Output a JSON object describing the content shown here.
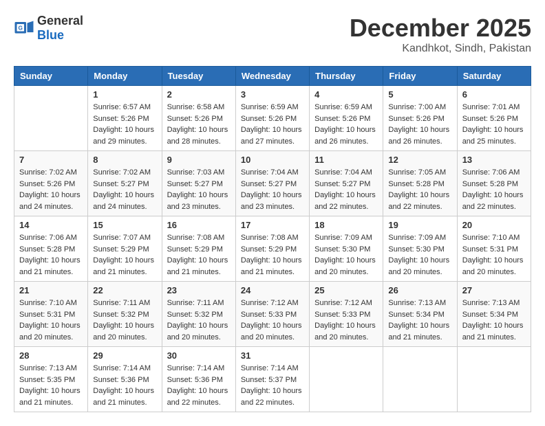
{
  "logo": {
    "general": "General",
    "blue": "Blue"
  },
  "title": "December 2025",
  "location": "Kandhkot, Sindh, Pakistan",
  "days_of_week": [
    "Sunday",
    "Monday",
    "Tuesday",
    "Wednesday",
    "Thursday",
    "Friday",
    "Saturday"
  ],
  "weeks": [
    [
      {
        "day": "",
        "sunrise": "",
        "sunset": "",
        "daylight": ""
      },
      {
        "day": "1",
        "sunrise": "Sunrise: 6:57 AM",
        "sunset": "Sunset: 5:26 PM",
        "daylight": "Daylight: 10 hours and 29 minutes."
      },
      {
        "day": "2",
        "sunrise": "Sunrise: 6:58 AM",
        "sunset": "Sunset: 5:26 PM",
        "daylight": "Daylight: 10 hours and 28 minutes."
      },
      {
        "day": "3",
        "sunrise": "Sunrise: 6:59 AM",
        "sunset": "Sunset: 5:26 PM",
        "daylight": "Daylight: 10 hours and 27 minutes."
      },
      {
        "day": "4",
        "sunrise": "Sunrise: 6:59 AM",
        "sunset": "Sunset: 5:26 PM",
        "daylight": "Daylight: 10 hours and 26 minutes."
      },
      {
        "day": "5",
        "sunrise": "Sunrise: 7:00 AM",
        "sunset": "Sunset: 5:26 PM",
        "daylight": "Daylight: 10 hours and 26 minutes."
      },
      {
        "day": "6",
        "sunrise": "Sunrise: 7:01 AM",
        "sunset": "Sunset: 5:26 PM",
        "daylight": "Daylight: 10 hours and 25 minutes."
      }
    ],
    [
      {
        "day": "7",
        "sunrise": "Sunrise: 7:02 AM",
        "sunset": "Sunset: 5:26 PM",
        "daylight": "Daylight: 10 hours and 24 minutes."
      },
      {
        "day": "8",
        "sunrise": "Sunrise: 7:02 AM",
        "sunset": "Sunset: 5:27 PM",
        "daylight": "Daylight: 10 hours and 24 minutes."
      },
      {
        "day": "9",
        "sunrise": "Sunrise: 7:03 AM",
        "sunset": "Sunset: 5:27 PM",
        "daylight": "Daylight: 10 hours and 23 minutes."
      },
      {
        "day": "10",
        "sunrise": "Sunrise: 7:04 AM",
        "sunset": "Sunset: 5:27 PM",
        "daylight": "Daylight: 10 hours and 23 minutes."
      },
      {
        "day": "11",
        "sunrise": "Sunrise: 7:04 AM",
        "sunset": "Sunset: 5:27 PM",
        "daylight": "Daylight: 10 hours and 22 minutes."
      },
      {
        "day": "12",
        "sunrise": "Sunrise: 7:05 AM",
        "sunset": "Sunset: 5:28 PM",
        "daylight": "Daylight: 10 hours and 22 minutes."
      },
      {
        "day": "13",
        "sunrise": "Sunrise: 7:06 AM",
        "sunset": "Sunset: 5:28 PM",
        "daylight": "Daylight: 10 hours and 22 minutes."
      }
    ],
    [
      {
        "day": "14",
        "sunrise": "Sunrise: 7:06 AM",
        "sunset": "Sunset: 5:28 PM",
        "daylight": "Daylight: 10 hours and 21 minutes."
      },
      {
        "day": "15",
        "sunrise": "Sunrise: 7:07 AM",
        "sunset": "Sunset: 5:29 PM",
        "daylight": "Daylight: 10 hours and 21 minutes."
      },
      {
        "day": "16",
        "sunrise": "Sunrise: 7:08 AM",
        "sunset": "Sunset: 5:29 PM",
        "daylight": "Daylight: 10 hours and 21 minutes."
      },
      {
        "day": "17",
        "sunrise": "Sunrise: 7:08 AM",
        "sunset": "Sunset: 5:29 PM",
        "daylight": "Daylight: 10 hours and 21 minutes."
      },
      {
        "day": "18",
        "sunrise": "Sunrise: 7:09 AM",
        "sunset": "Sunset: 5:30 PM",
        "daylight": "Daylight: 10 hours and 20 minutes."
      },
      {
        "day": "19",
        "sunrise": "Sunrise: 7:09 AM",
        "sunset": "Sunset: 5:30 PM",
        "daylight": "Daylight: 10 hours and 20 minutes."
      },
      {
        "day": "20",
        "sunrise": "Sunrise: 7:10 AM",
        "sunset": "Sunset: 5:31 PM",
        "daylight": "Daylight: 10 hours and 20 minutes."
      }
    ],
    [
      {
        "day": "21",
        "sunrise": "Sunrise: 7:10 AM",
        "sunset": "Sunset: 5:31 PM",
        "daylight": "Daylight: 10 hours and 20 minutes."
      },
      {
        "day": "22",
        "sunrise": "Sunrise: 7:11 AM",
        "sunset": "Sunset: 5:32 PM",
        "daylight": "Daylight: 10 hours and 20 minutes."
      },
      {
        "day": "23",
        "sunrise": "Sunrise: 7:11 AM",
        "sunset": "Sunset: 5:32 PM",
        "daylight": "Daylight: 10 hours and 20 minutes."
      },
      {
        "day": "24",
        "sunrise": "Sunrise: 7:12 AM",
        "sunset": "Sunset: 5:33 PM",
        "daylight": "Daylight: 10 hours and 20 minutes."
      },
      {
        "day": "25",
        "sunrise": "Sunrise: 7:12 AM",
        "sunset": "Sunset: 5:33 PM",
        "daylight": "Daylight: 10 hours and 20 minutes."
      },
      {
        "day": "26",
        "sunrise": "Sunrise: 7:13 AM",
        "sunset": "Sunset: 5:34 PM",
        "daylight": "Daylight: 10 hours and 21 minutes."
      },
      {
        "day": "27",
        "sunrise": "Sunrise: 7:13 AM",
        "sunset": "Sunset: 5:34 PM",
        "daylight": "Daylight: 10 hours and 21 minutes."
      }
    ],
    [
      {
        "day": "28",
        "sunrise": "Sunrise: 7:13 AM",
        "sunset": "Sunset: 5:35 PM",
        "daylight": "Daylight: 10 hours and 21 minutes."
      },
      {
        "day": "29",
        "sunrise": "Sunrise: 7:14 AM",
        "sunset": "Sunset: 5:36 PM",
        "daylight": "Daylight: 10 hours and 21 minutes."
      },
      {
        "day": "30",
        "sunrise": "Sunrise: 7:14 AM",
        "sunset": "Sunset: 5:36 PM",
        "daylight": "Daylight: 10 hours and 22 minutes."
      },
      {
        "day": "31",
        "sunrise": "Sunrise: 7:14 AM",
        "sunset": "Sunset: 5:37 PM",
        "daylight": "Daylight: 10 hours and 22 minutes."
      },
      {
        "day": "",
        "sunrise": "",
        "sunset": "",
        "daylight": ""
      },
      {
        "day": "",
        "sunrise": "",
        "sunset": "",
        "daylight": ""
      },
      {
        "day": "",
        "sunrise": "",
        "sunset": "",
        "daylight": ""
      }
    ]
  ]
}
